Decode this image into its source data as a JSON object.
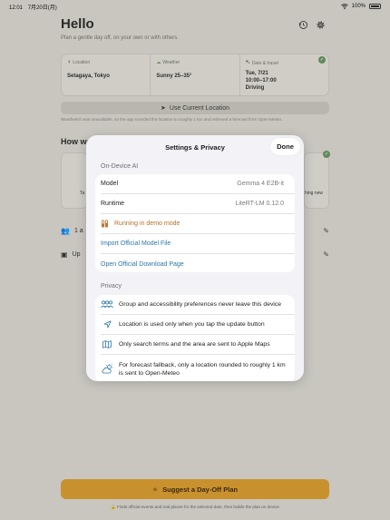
{
  "status_bar": {
    "time": "12:01",
    "date": "7月20日(月)",
    "battery": "100%"
  },
  "header": {
    "title": "Hello",
    "subtitle": "Plan a gentle day off, on your own or with others."
  },
  "info_card": {
    "location": {
      "label": "Location",
      "value": "Setagaya, Tokyo"
    },
    "weather": {
      "label": "Weather",
      "value": "Sunny 25–35°"
    },
    "date_travel": {
      "label": "Date & travel",
      "date": "Tue, 7/21",
      "time": "10:00–17:00",
      "mode": "Driving"
    }
  },
  "location_button": "Use Current Location",
  "weather_note": "WeatherKit was unavailable, so the app rounded the location to roughly 1 km and retrieved a forecast from Open-Meteo.",
  "section_title": "How wo",
  "tiles": {
    "left": "Ta",
    "right": "hing new"
  },
  "rows": {
    "people": "1 a",
    "update": "Up"
  },
  "suggest_button": "Suggest a Day-Off Plan",
  "footnote": "Finds official events and real places for the selected date, then builds the plan on device",
  "settings": {
    "title": "Settings & Privacy",
    "done": "Done",
    "on_device": {
      "header": "On-Device AI",
      "model_label": "Model",
      "model_value": "Gemma 4 E2B-it",
      "runtime_label": "Runtime",
      "runtime_value": "LiteRT-LM 0.12.0",
      "demo_mode": "Running in demo mode",
      "import": "Import Official Model File",
      "download": "Open Official Download Page"
    },
    "privacy": {
      "header": "Privacy",
      "items": [
        {
          "icon": "people-icon",
          "text": "Group and accessibility preferences never leave this device"
        },
        {
          "icon": "location-arrow-icon",
          "text": "Location is used only when you tap the update button"
        },
        {
          "icon": "map-icon",
          "text": "Only search terms and the area are sent to Apple Maps"
        },
        {
          "icon": "cloud-sun-icon",
          "text": "For forecast fallback, only a location rounded to roughly 1 km is sent to Open-Meteo"
        }
      ]
    }
  },
  "colors": {
    "accent": "#2e78a8",
    "demo": "#b5702a",
    "suggest": "#c9912e",
    "check": "#5f8a5c"
  }
}
